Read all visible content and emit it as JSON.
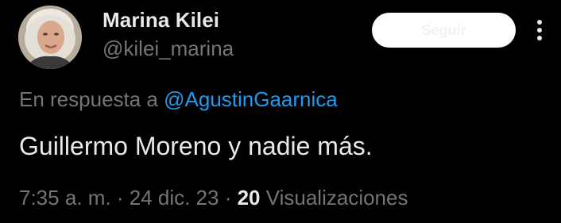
{
  "author": {
    "display_name": "Marina Kilei",
    "handle": "@kilei_marina"
  },
  "follow_button": {
    "label": "Seguir"
  },
  "more_button": {
    "icon": "more-vertical-icon"
  },
  "reply": {
    "prefix": "En respuesta a ",
    "mention": "@AgustinGaarnica"
  },
  "tweet": {
    "text": "Guillermo Moreno y nadie más."
  },
  "meta": {
    "time": "7:35 a. m.",
    "separator1": " · ",
    "date": "24 dic. 23",
    "separator2": " · ",
    "views_count": "20",
    "views_label": " Visualizaciones"
  },
  "colors": {
    "background": "#000000",
    "primary_text": "#e7e9ea",
    "secondary_text": "#71767b",
    "link": "#1d9bf0",
    "button_bg": "#ffffff"
  }
}
